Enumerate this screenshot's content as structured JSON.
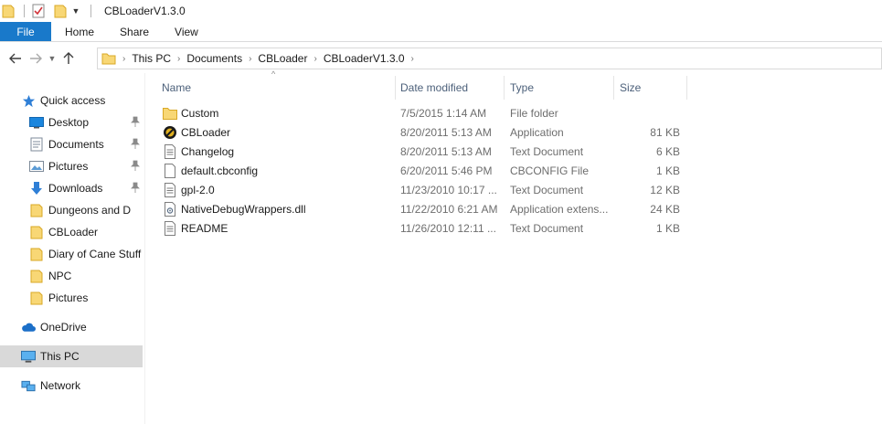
{
  "window": {
    "title": "CBLoaderV1.3.0"
  },
  "ribbon": {
    "file": "File",
    "tabs": [
      "Home",
      "Share",
      "View"
    ]
  },
  "address": {
    "crumbs": [
      "This PC",
      "Documents",
      "CBLoader",
      "CBLoaderV1.3.0"
    ]
  },
  "sidebar": {
    "items": [
      {
        "label": "Quick access",
        "icon": "star-icon",
        "level": "root",
        "pinned": false
      },
      {
        "label": "Desktop",
        "icon": "desktop-icon",
        "level": "child",
        "pinned": true
      },
      {
        "label": "Documents",
        "icon": "documents-icon",
        "level": "child",
        "pinned": true
      },
      {
        "label": "Pictures",
        "icon": "pictures-icon",
        "level": "child",
        "pinned": true
      },
      {
        "label": "Downloads",
        "icon": "download-arrow-icon",
        "level": "child",
        "pinned": true
      },
      {
        "label": "Dungeons and D",
        "icon": "folder-icon",
        "level": "child",
        "pinned": false
      },
      {
        "label": "CBLoader",
        "icon": "folder-icon",
        "level": "child",
        "pinned": false
      },
      {
        "label": "Diary of Cane Stuff",
        "icon": "folder-icon",
        "level": "child",
        "pinned": false
      },
      {
        "label": "NPC",
        "icon": "folder-icon",
        "level": "child",
        "pinned": false
      },
      {
        "label": "Pictures",
        "icon": "folder-icon",
        "level": "child",
        "pinned": false
      },
      {
        "label": "OneDrive",
        "icon": "cloud-icon",
        "level": "root",
        "pinned": false
      },
      {
        "label": "This PC",
        "icon": "monitor-icon",
        "level": "root",
        "pinned": false,
        "selected": true
      },
      {
        "label": "Network",
        "icon": "network-icon",
        "level": "root",
        "pinned": false
      }
    ]
  },
  "columns": {
    "name": "Name",
    "date": "Date modified",
    "type": "Type",
    "size": "Size"
  },
  "files": [
    {
      "name": "Custom",
      "date": "7/5/2015 1:14 AM",
      "type": "File folder",
      "size": "",
      "icon": "folder-icon"
    },
    {
      "name": "CBLoader",
      "date": "8/20/2011 5:13 AM",
      "type": "Application",
      "size": "81 KB",
      "icon": "app-emblem-icon"
    },
    {
      "name": "Changelog",
      "date": "8/20/2011 5:13 AM",
      "type": "Text Document",
      "size": "6 KB",
      "icon": "text-file-icon"
    },
    {
      "name": "default.cbconfig",
      "date": "6/20/2011 5:46 PM",
      "type": "CBCONFIG File",
      "size": "1 KB",
      "icon": "blank-file-icon"
    },
    {
      "name": "gpl-2.0",
      "date": "11/23/2010 10:17 ...",
      "type": "Text Document",
      "size": "12 KB",
      "icon": "text-file-icon"
    },
    {
      "name": "NativeDebugWrappers.dll",
      "date": "11/22/2010 6:21 AM",
      "type": "Application extens...",
      "size": "24 KB",
      "icon": "dll-file-icon"
    },
    {
      "name": "README",
      "date": "11/26/2010 12:11 ...",
      "type": "Text Document",
      "size": "1 KB",
      "icon": "text-file-icon"
    }
  ]
}
